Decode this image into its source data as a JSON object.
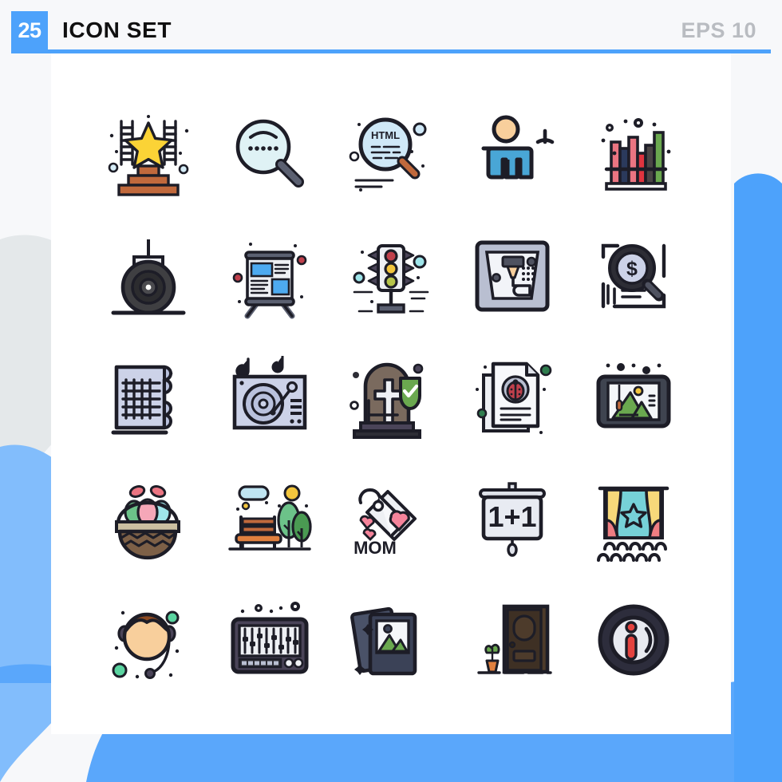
{
  "header": {
    "badge_count": "25",
    "title": "ICON SET",
    "format_label": "EPS 10"
  },
  "theme": {
    "accent": "#4da2fb",
    "accent_light": "#82bdfc",
    "accent_pale": "#e4e8ea",
    "page_bg": "#f7f8fa",
    "card_bg": "#ffffff",
    "stroke": "#1d1d27",
    "title_color": "#101010",
    "muted_text": "#b9bcc1"
  },
  "grid": {
    "columns": 5,
    "rows": 5,
    "total_icons": 25
  },
  "icons": [
    {
      "id": 1,
      "name": "star-podium-icon",
      "label": "Award Podium",
      "row": 1,
      "col": 1
    },
    {
      "id": 2,
      "name": "search-dots-icon",
      "label": "Search",
      "row": 1,
      "col": 2
    },
    {
      "id": 3,
      "name": "html-code-search-icon",
      "label": "HTML Code Search",
      "row": 1,
      "col": 3
    },
    {
      "id": 4,
      "name": "person-gauge-icon",
      "label": "Performance",
      "row": 1,
      "col": 4
    },
    {
      "id": 5,
      "name": "bookshelf-icon",
      "label": "Bookshelf",
      "row": 1,
      "col": 5
    },
    {
      "id": 6,
      "name": "wheel-roller-icon",
      "label": "Roller",
      "row": 2,
      "col": 1
    },
    {
      "id": 7,
      "name": "presentation-board-icon",
      "label": "Presentation",
      "row": 2,
      "col": 2
    },
    {
      "id": 8,
      "name": "traffic-light-icon",
      "label": "Traffic Light",
      "row": 2,
      "col": 3
    },
    {
      "id": 9,
      "name": "cnc-machine-icon",
      "label": "CNC Machine",
      "row": 2,
      "col": 4
    },
    {
      "id": 10,
      "name": "dollar-search-icon",
      "label": "Financial Search",
      "row": 2,
      "col": 5
    },
    {
      "id": 11,
      "name": "blueprint-icon",
      "label": "Blueprint",
      "row": 3,
      "col": 1
    },
    {
      "id": 12,
      "name": "turntable-icon",
      "label": "Turntable",
      "row": 3,
      "col": 2
    },
    {
      "id": 13,
      "name": "tombstone-shield-icon",
      "label": "Life Insurance",
      "row": 3,
      "col": 3
    },
    {
      "id": 14,
      "name": "bug-report-icon",
      "label": "Bug Report",
      "row": 3,
      "col": 4
    },
    {
      "id": 15,
      "name": "framed-picture-icon",
      "label": "Framed Picture",
      "row": 3,
      "col": 5
    },
    {
      "id": 16,
      "name": "easter-basket-icon",
      "label": "Easter Basket",
      "row": 4,
      "col": 1
    },
    {
      "id": 17,
      "name": "park-bench-icon",
      "label": "Park Bench",
      "row": 4,
      "col": 2
    },
    {
      "id": 18,
      "name": "mom-tag-icon",
      "label": "Mothers Day Tag",
      "row": 4,
      "col": 3
    },
    {
      "id": 19,
      "name": "one-plus-one-board-icon",
      "label": "1+1 Offer Board",
      "row": 4,
      "col": 4
    },
    {
      "id": 20,
      "name": "theater-stage-icon",
      "label": "Theater Stage",
      "row": 4,
      "col": 5
    },
    {
      "id": 21,
      "name": "support-agent-icon",
      "label": "Support Agent",
      "row": 5,
      "col": 1
    },
    {
      "id": 22,
      "name": "audio-mixer-icon",
      "label": "Audio Mixer",
      "row": 5,
      "col": 2
    },
    {
      "id": 23,
      "name": "photo-stack-icon",
      "label": "Photos",
      "row": 5,
      "col": 3
    },
    {
      "id": 24,
      "name": "front-door-icon",
      "label": "Front Door",
      "row": 5,
      "col": 4
    },
    {
      "id": 25,
      "name": "info-circle-icon",
      "label": "Information",
      "row": 5,
      "col": 5
    }
  ],
  "icon_text": {
    "html_label": "HTML",
    "mom_label": "MOM",
    "offer_label": "1+1",
    "dollar_label": "$",
    "info_label": "i"
  }
}
